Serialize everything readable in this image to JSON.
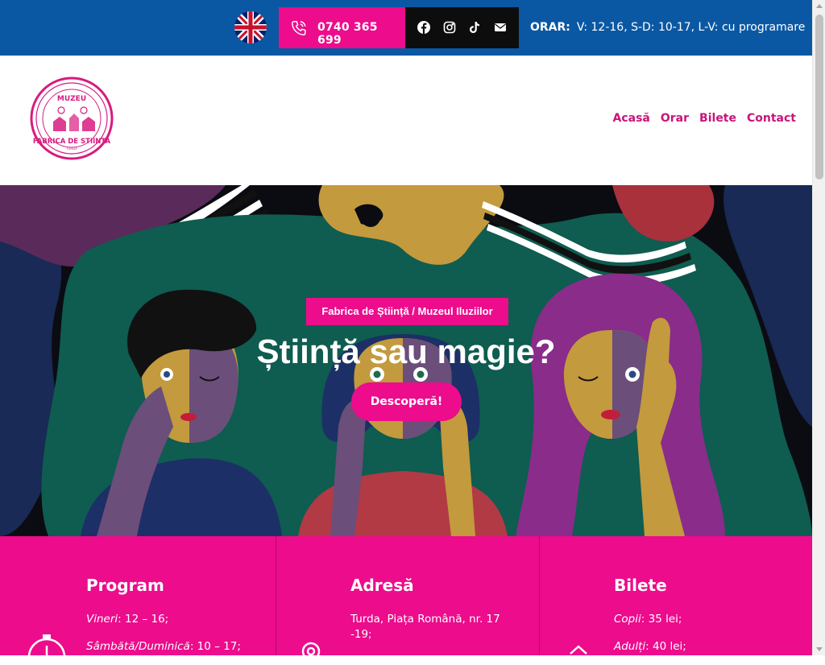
{
  "topbar": {
    "language_flag": "uk-flag-icon",
    "phone": "0740 365 699",
    "social_icons": [
      "facebook-icon",
      "instagram-icon",
      "tiktok-icon",
      "email-icon"
    ],
    "hours_label": "ORAR:",
    "hours_text": "V: 12-16, S-D: 10-17, L-V: cu programare"
  },
  "header": {
    "logo_text_top": "MUZEU",
    "logo_text_main": "FABRICA DE STIINTA",
    "nav": [
      "Acasă",
      "Orar",
      "Bilete",
      "Contact"
    ]
  },
  "hero": {
    "tag": "Fabrica de Știință / Muzeul Iluziilor",
    "title": "Știință sau magie?",
    "button": "Descoperă!"
  },
  "info": {
    "program": {
      "title": "Program",
      "lines": [
        {
          "label": "Vineri",
          "value": ": 12 – 16;"
        },
        {
          "label": "Sâmbătă/Duminică",
          "value": ": 10 – 17;"
        }
      ]
    },
    "adresa": {
      "title": "Adresă",
      "line1": "Turda, Piața Română, nr. 17",
      "line2": "-19;"
    },
    "bilete": {
      "title": "Bilete",
      "lines": [
        {
          "label": "Copii",
          "value": ": 35 lei;"
        },
        {
          "label": "Adulți",
          "value": ": 40 lei;"
        }
      ]
    }
  },
  "colors": {
    "topbar": "#0a58a3",
    "accent": "#ec0c8c",
    "nav": "#c8157a"
  }
}
